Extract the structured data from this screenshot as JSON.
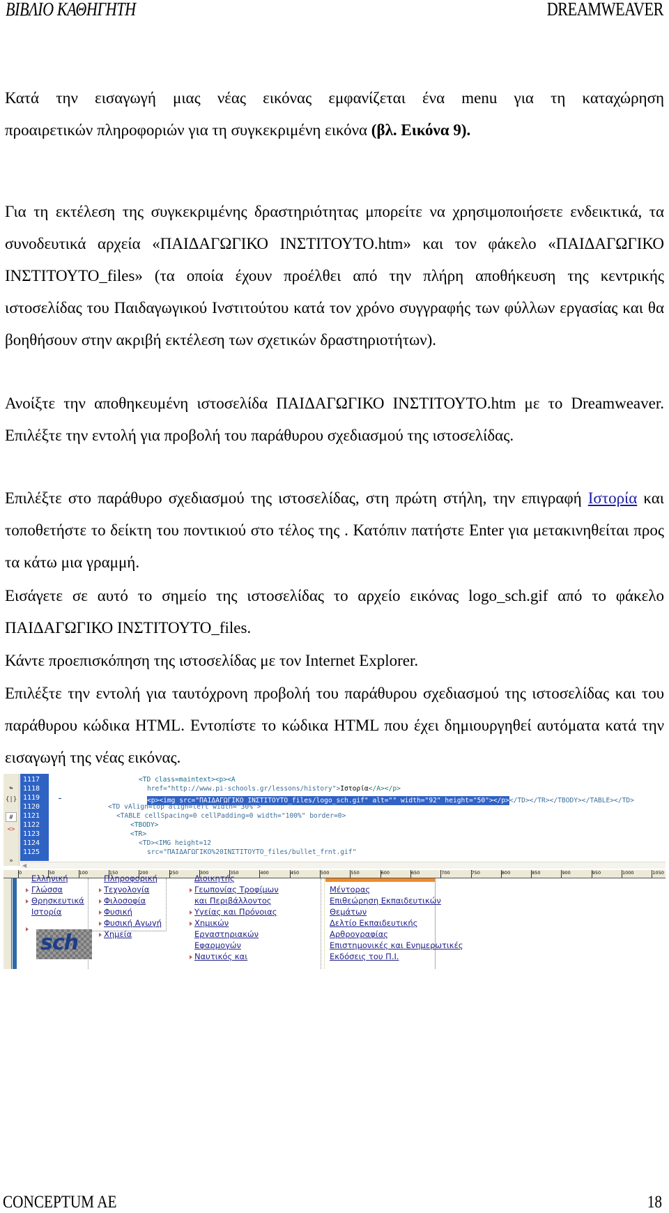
{
  "header": {
    "left": "ΒΙΒΛΙΟ ΚΑΘΗΓΗΤΗ",
    "right": "DREAMWEAVER"
  },
  "paragraphs": {
    "p1_line1": "Κατά την εισαγωγή μιας νέας εικόνας εμφανίζεται ένα menu για τη καταχώρηση",
    "p1_line2_a": "προαιρετικών πληροφοριών για τη συγκεκριμένη εικόνα ",
    "p1_line2_bold": "(βλ. Εικόνα 9).",
    "p2": "Για τη εκτέλεση της συγκεκριμένης δραστηριότητας μπορείτε να χρησιμοποιήσετε ενδεικτικά, τα συνοδευτικά αρχεία «ΠΑΙΔΑΓΩΓΙΚΟ ΙΝΣΤΙΤΟΥΤΟ.htm»  και τον φάκελο «ΠΑΙΔΑΓΩΓΙΚΟ ΙΝΣΤΙΤΟΥΤΟ_files» (τα οποία έχουν προέλθει από την πλήρη αποθήκευση της κεντρικής ιστοσελίδας του Παιδαγωγικού Ινστιτούτου κατά τον χρόνο συγγραφής των φύλλων εργασίας και θα βοηθήσουν στην ακριβή εκτέλεση των σχετικών δραστηριοτήτων).",
    "p3": "Ανοίξτε την αποθηκευμένη ιστοσελίδα ΠΑΙΔΑΓΩΓΙΚΟ ΙΝΣΤΙΤΟΥΤΟ.htm με το Dreamweaver. Επιλέξτε την εντολή για προβολή του παράθυρου σχεδιασμού της ιστοσελίδας.",
    "p4_a": "Επιλέξτε στο  παράθυρο σχεδιασμού της ιστοσελίδας, στη πρώτη στήλη, την επιγραφή ",
    "p4_link": "Ιστορία",
    "p4_b": " και τοποθετήστε το δείκτη του ποντικιού στο τέλος της . Κατόπιν πατήστε Enter για μετακινηθείται προς τα κάτω μια γραμμή.",
    "p5": "Εισάγετε σε αυτό το σημείο της ιστοσελίδας το αρχείο εικόνας logo_sch.gif από το φάκελο ΠΑΙΔΑΓΩΓΙΚΟ ΙΝΣΤΙΤΟΥΤΟ_files.",
    "p6": "Κάντε προεπισκόπηση της ιστοσελίδας με τον Internet Explorer.",
    "p7": "Επιλέξτε  την εντολή για ταυτόχρονη προβολή του παράθυρου σχεδιασμού της ιστοσελίδας και του παράθυρου κώδικα HTML. Εντοπίστε το κώδικα HTML που έχει δημιουργηθεί αυτόματα κατά την εισαγωγή της νέας εικόνας."
  },
  "screenshot": {
    "line_numbers": [
      "1117",
      "1118",
      "1119",
      "1120",
      "1121",
      "1122",
      "1123",
      "1124",
      "1125"
    ],
    "code": {
      "l1117": "<TD class=maintext><p><A",
      "l1118_a": "href=\"http://www.pi-schools.gr/lessons/history\">",
      "l1118_txt": "Ιστορία",
      "l1118_b": "</A></p>",
      "l1119_sel": "<p><img src=\"ΠΑΙΔΑΓΩΓΙΚΟ ΙΝΣΤΙΤΟΥΤΟ_files/logo_sch.gif\" alt=\"\" width=\"92\" height=\"50\"></p>",
      "l1119_rest": "</TD></TR></TBODY></TABLE></TD>",
      "l1120": "<TD vAlign=top align=left width=\"30%\">",
      "l1121": "<TABLE cellSpacing=0 cellPadding=0 width=\"100%\" border=0>",
      "l1122": "<TBODY>",
      "l1123": "<TR>",
      "l1124": "<TD><IMG height=12",
      "l1125": "src=\"ΠΑΙΔΑΓΩΓΙΚΟ%20ΙΝΣΤΙΤΟΥΤΟ_files/bullet_frnt.gif\""
    },
    "ruler_ticks": [
      "0",
      "50",
      "100",
      "150",
      "200",
      "250",
      "300",
      "350",
      "400",
      "450",
      "500",
      "550",
      "600",
      "650",
      "700",
      "750",
      "800",
      "850",
      "900",
      "950",
      "1000",
      "1050"
    ],
    "design": {
      "col1": [
        "Ελληνική",
        "Γλώσσα",
        "Θρησκευτικά",
        "Ιστορία"
      ],
      "col2": [
        "Πληροφορική",
        "Τεχνολογία",
        "Φιλοσοφία",
        "Φυσική",
        "Φυσική Αγωγή",
        "Χημεία"
      ],
      "col3": [
        "Διοικητής",
        "Γεωπονίας Τροφίμων",
        "και Περιβάλλοντος",
        "Υγείας και Πρόνοιας",
        "Χημικών",
        "Εργαστηριακών",
        "Εφαρμογών",
        "Ναυτικός και"
      ],
      "col4": [
        "Μέντορας",
        "Επιθεώρηση Εκπαιδευτικών",
        "Θεμάτων",
        "Δελτίο Εκπαιδευτικής",
        "Αρθρογραφίας",
        "Επιστημονικές και Ενημερωτικές",
        "Εκδόσεις του Π.Ι."
      ],
      "logo_text": "sch"
    }
  },
  "footer": {
    "left": "CONCEPTUM AE",
    "page_number": "18"
  }
}
